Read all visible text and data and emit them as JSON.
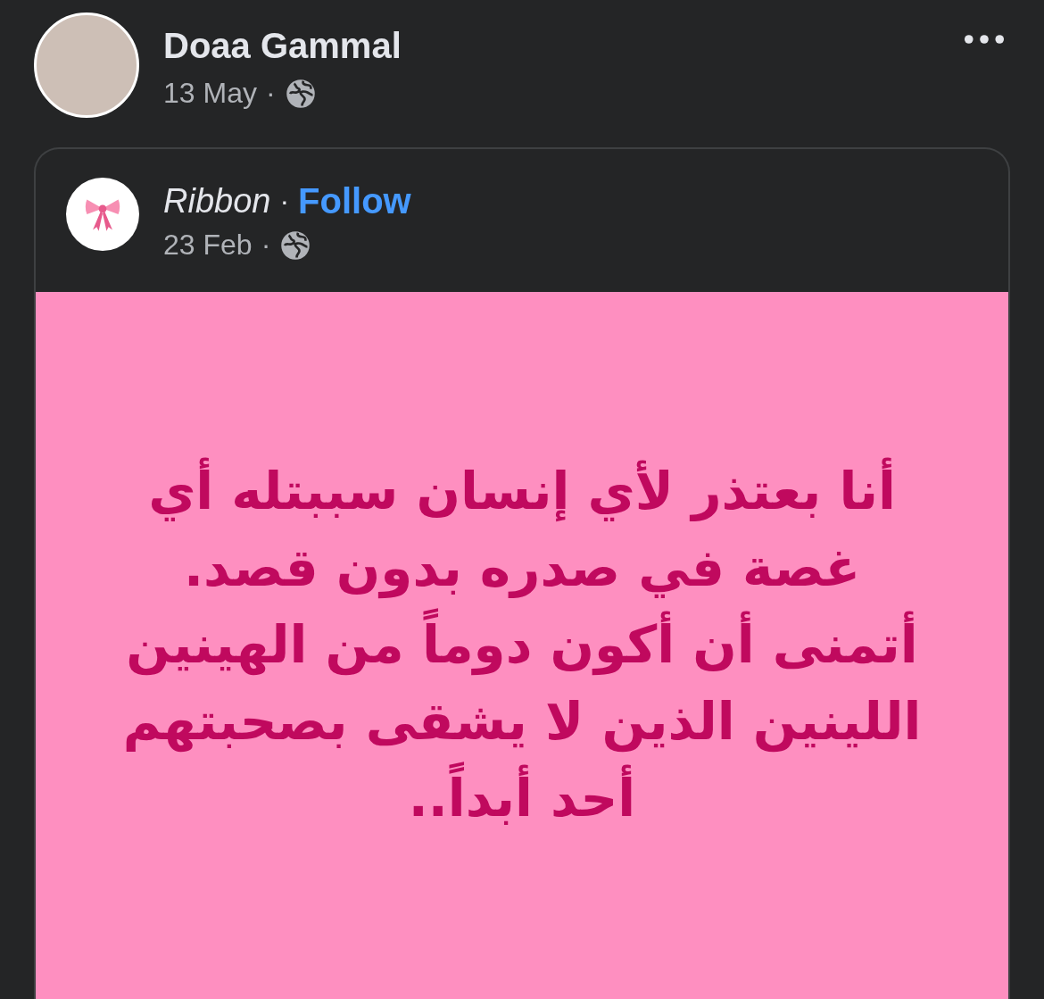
{
  "post": {
    "author": "Doaa Gammal",
    "date": "13 May",
    "separator": "·",
    "shared_post": {
      "author": "Ribbon",
      "separator": "·",
      "follow": "Follow",
      "date": "23 Feb",
      "date_separator": "·",
      "text": "أنا بعتذر لأي إنسان سببتله أي غصة في صدره بدون قصد. أتمنى أن أكون دوماً من الهينين اللينين الذين لا يشقى بصحبتهم أحد أبداً.."
    }
  }
}
